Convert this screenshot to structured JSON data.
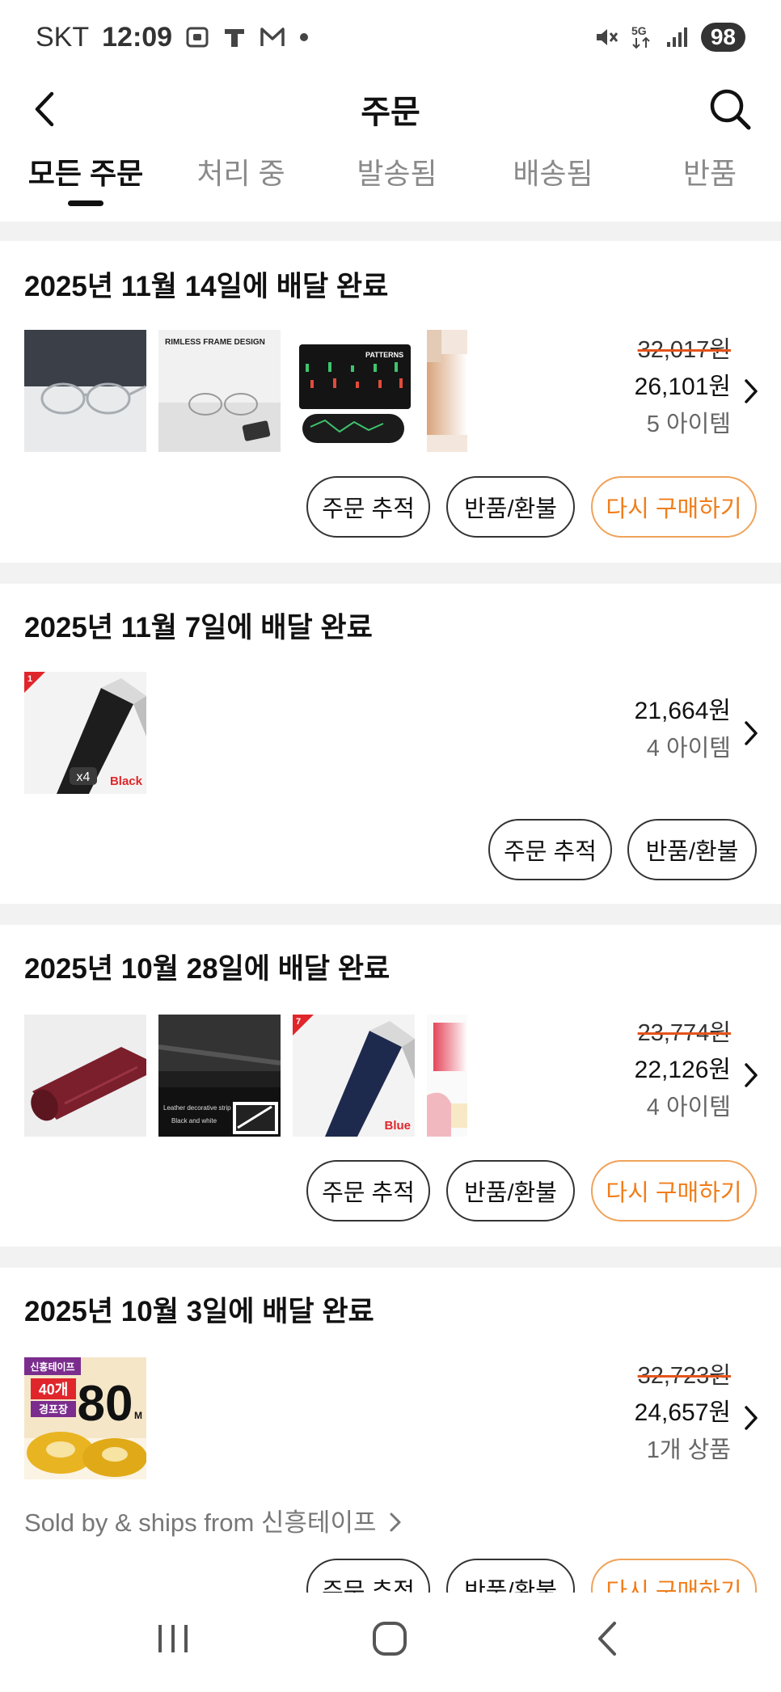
{
  "status_bar": {
    "carrier": "SKT",
    "time": "12:09",
    "battery": "98",
    "icons": [
      "screenshot-icon",
      "t-icon",
      "mail-icon",
      "dot-icon",
      "mute-icon",
      "5g-icon",
      "signal-icon"
    ]
  },
  "header": {
    "title": "주문",
    "back_icon": "back-chevron-icon",
    "search_icon": "search-icon"
  },
  "tabs": [
    {
      "label": "모든 주문",
      "active": true
    },
    {
      "label": "처리 중",
      "active": false
    },
    {
      "label": "발송됨",
      "active": false
    },
    {
      "label": "배송됨",
      "active": false
    },
    {
      "label": "반품",
      "active": false
    }
  ],
  "orders": [
    {
      "date_label": "2025년 11월 14일에 배달 완료",
      "original_price": "32,017원",
      "price": "26,101원",
      "item_count": "5 아이템",
      "thumbnails": [
        "glasses-photo",
        "rimless-frame-glasses",
        "chart-patterns-mousepad",
        "wood-product-partial"
      ],
      "thumb_text": {
        "rimless": "RIMLESS FRAME DESIGN",
        "patterns": "PATTERNS"
      },
      "buttons": {
        "track": "주문 추적",
        "return": "반품/환불",
        "rebuy": "다시 구매하기"
      }
    },
    {
      "date_label": "2025년 11월 7일에 배달 완료",
      "original_price": "",
      "price": "21,664원",
      "item_count": "4 아이템",
      "thumbnails": [
        "black-felt-sheet"
      ],
      "thumb_text": {
        "corner_num": "1",
        "count": "x4",
        "variant": "Black"
      },
      "buttons": {
        "track": "주문 추적",
        "return": "반품/환불"
      }
    },
    {
      "date_label": "2025년 10월 28일에 배달 완료",
      "original_price": "23,774원",
      "price": "22,126원",
      "item_count": "4 아이템",
      "thumbnails": [
        "red-roll-film",
        "black-white-strip",
        "blue-felt-sheet",
        "pink-scraper-partial"
      ],
      "thumb_text": {
        "strip_line1": "Leather decorative strip",
        "strip_line2": "Black and white",
        "corner_num": "7",
        "variant": "Blue"
      },
      "buttons": {
        "track": "주문 추적",
        "return": "반품/환불",
        "rebuy": "다시 구매하기"
      }
    },
    {
      "date_label": "2025년 10월 3일에 배달 완료",
      "original_price": "32,723원",
      "price": "24,657원",
      "item_count": "1개 상품",
      "thumbnails": [
        "packing-tape-box"
      ],
      "thumb_text": {
        "brand": "신흥테이프",
        "qty": "40개",
        "type": "경포장",
        "size": "80",
        "unit": "M"
      },
      "seller": "Sold by & ships from 신흥테이프",
      "buttons": {
        "track": "주문 추적",
        "return": "반품/환불",
        "rebuy": "다시 구매하기"
      }
    }
  ],
  "navbar": {
    "icons": [
      "recents-icon",
      "home-icon",
      "back-icon"
    ]
  }
}
